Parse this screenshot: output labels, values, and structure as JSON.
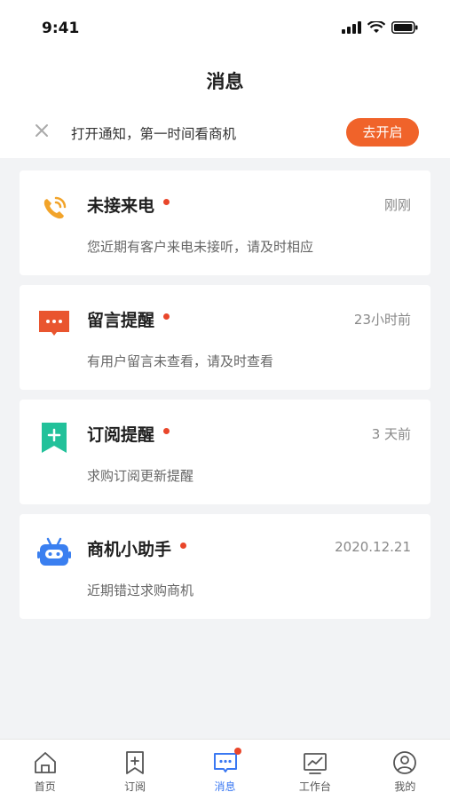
{
  "status_bar": {
    "time": "9:41"
  },
  "header": {
    "title": "消息"
  },
  "notice": {
    "text": "打开通知，第一时间看商机",
    "button_label": "去开启"
  },
  "messages": [
    {
      "icon": "phone-icon",
      "title": "未接来电",
      "time": "刚刚",
      "desc": "您近期有客户来电未接听，请及时相应"
    },
    {
      "icon": "comment-icon",
      "title": "留言提醒",
      "time": "23小时前",
      "desc": "有用户留言未查看，请及时查看"
    },
    {
      "icon": "bookmark-icon",
      "title": "订阅提醒",
      "time": "3 天前",
      "desc": "求购订阅更新提醒"
    },
    {
      "icon": "robot-icon",
      "title": "商机小助手",
      "time": "2020.12.21",
      "desc": "近期错过求购商机"
    }
  ],
  "tabs": [
    {
      "label": "首页",
      "icon": "home-icon"
    },
    {
      "label": "订阅",
      "icon": "bookmark-icon"
    },
    {
      "label": "消息",
      "icon": "message-icon",
      "active": true
    },
    {
      "label": "工作台",
      "icon": "dashboard-icon"
    },
    {
      "label": "我的",
      "icon": "profile-icon"
    }
  ],
  "colors": {
    "accent": "#f0632a",
    "unread_dot": "#e9462a",
    "active_tab": "#3a78f2"
  }
}
